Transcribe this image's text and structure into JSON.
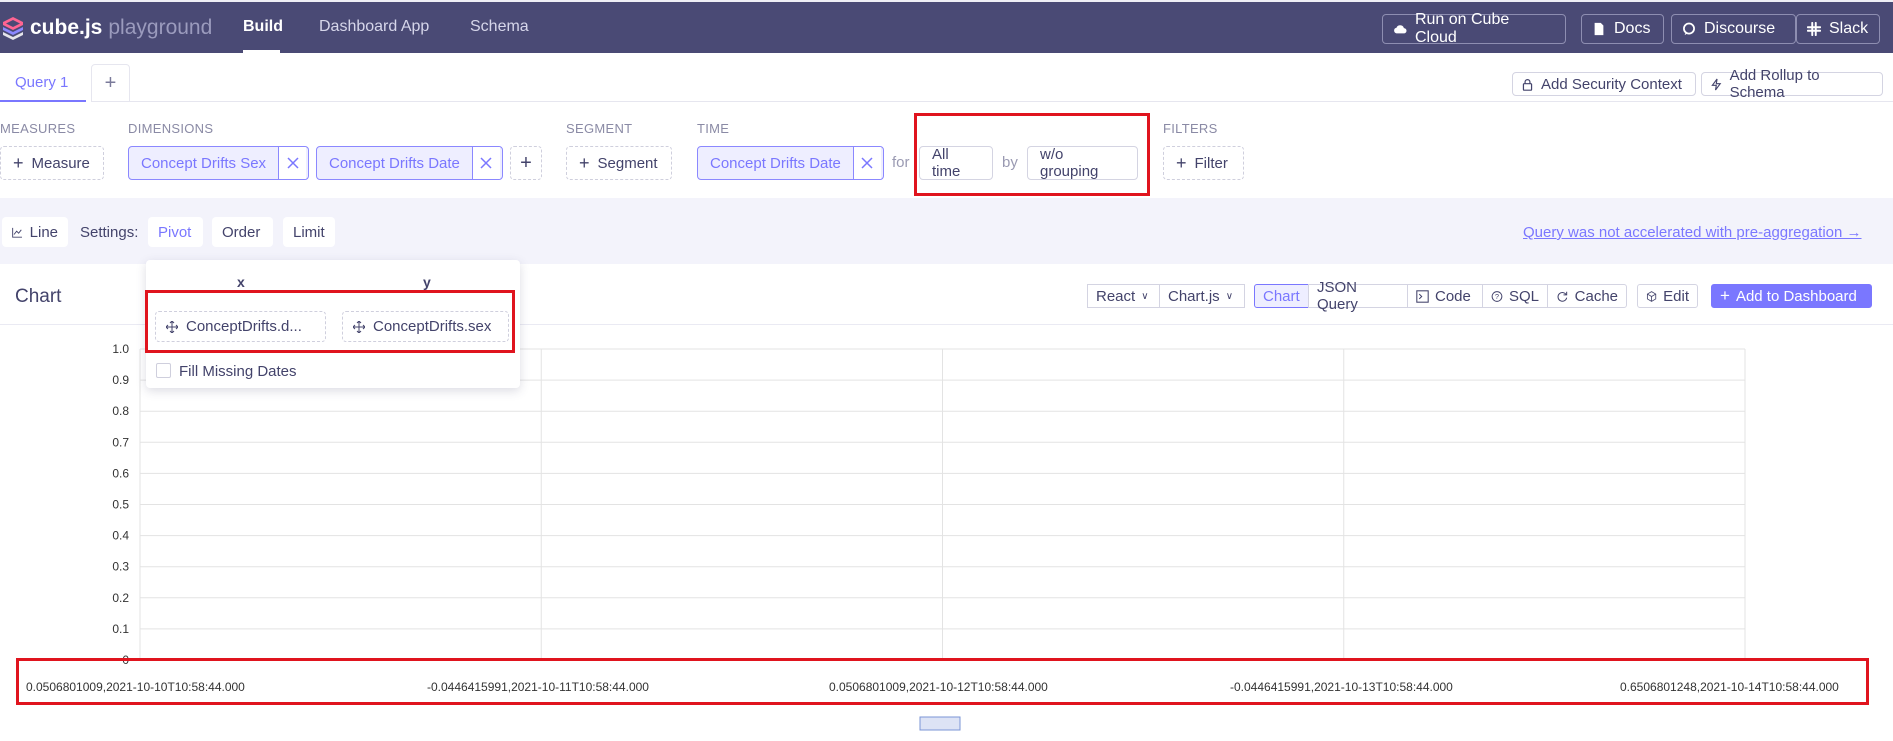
{
  "topbar": {
    "logo_main": "cube.js",
    "logo_sub": "playground",
    "nav": [
      "Build",
      "Dashboard App",
      "Schema"
    ],
    "buttons": {
      "cube_cloud": "Run on Cube Cloud",
      "docs": "Docs",
      "discourse": "Discourse",
      "slack": "Slack"
    }
  },
  "tabs": {
    "query_label": "Query 1",
    "add_label": "+",
    "security_context": "Add Security Context",
    "add_rollup": "Add Rollup to Schema"
  },
  "query": {
    "measures_label": "MEASURES",
    "measure_button": "Measure",
    "dimensions_label": "DIMENSIONS",
    "dimensions": [
      "Concept Drifts Sex",
      "Concept Drifts Date"
    ],
    "segment_label": "SEGMENT",
    "segment_button": "Segment",
    "time_label": "TIME",
    "time_dimension": "Concept Drifts Date",
    "for_word": "for",
    "date_range": "All time",
    "by_word": "by",
    "granularity": "w/o grouping",
    "filters_label": "FILTERS",
    "filter_button": "Filter"
  },
  "settings": {
    "chart_type": "Line",
    "settings_label": "Settings:",
    "pivot": "Pivot",
    "order": "Order",
    "limit": "Limit",
    "accel_link": "Query was not accelerated with pre-aggregation →"
  },
  "card": {
    "title": "Chart",
    "framework": "React",
    "library": "Chart.js",
    "tabs": [
      "Chart",
      "JSON Query",
      "Code",
      "SQL",
      "Cache"
    ],
    "edit": "Edit",
    "add_dashboard": "Add to Dashboard"
  },
  "pivot": {
    "x_header": "x",
    "y_header": "y",
    "x_item": "ConceptDrifts.d...",
    "y_item": "ConceptDrifts.sex",
    "fill_missing": "Fill Missing Dates"
  },
  "chart_data": {
    "type": "line",
    "categories": [
      "0.0506801009,2021-10-10T10:58:44.000",
      "-0.0446415991,2021-10-11T10:58:44.000",
      "0.0506801009,2021-10-12T10:58:44.000",
      "-0.0446415991,2021-10-13T10:58:44.000",
      "0.6506801248,2021-10-14T10:58:44.000"
    ],
    "y_ticks": [
      "0",
      "0.1",
      "0.2",
      "0.3",
      "0.4",
      "0.5",
      "0.6",
      "0.7",
      "0.8",
      "0.9",
      "1.0"
    ],
    "ylim": [
      0,
      1.0
    ],
    "series": [],
    "grid": true
  }
}
